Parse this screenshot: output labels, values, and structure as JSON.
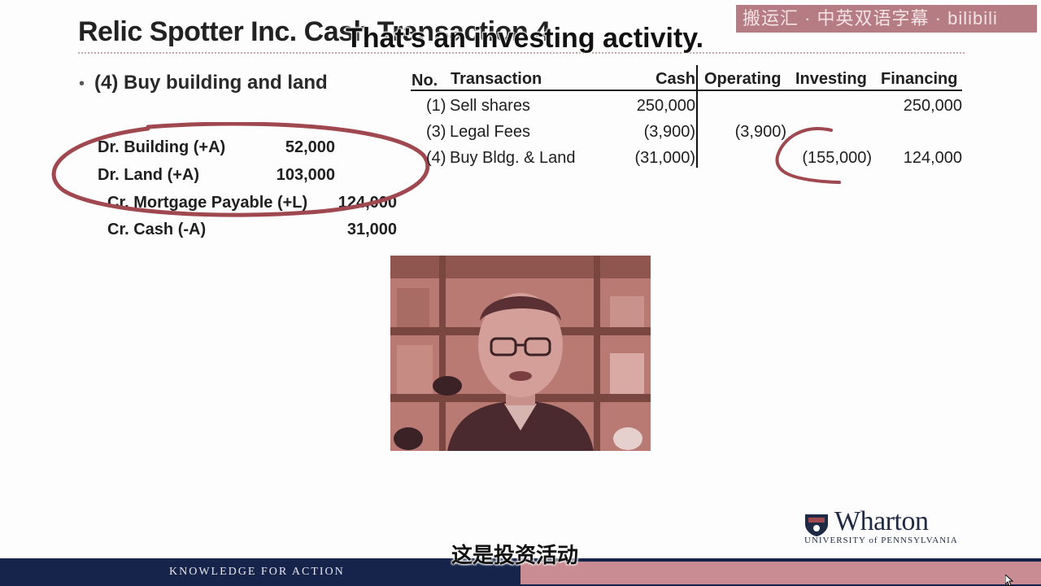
{
  "slide": {
    "title": "Relic Spotter Inc. Cash Transaction 4",
    "bullet": "(4) Buy building  and land"
  },
  "journal_entry": [
    {
      "account": "Dr. Building (+A)",
      "amount": "52,000"
    },
    {
      "account": "Dr. Land (+A)",
      "amount": "103,000"
    },
    {
      "account": "Cr. Mortgage Payable (+L)",
      "amount": "124,000"
    },
    {
      "account": "Cr. Cash (-A)",
      "amount": "31,000"
    }
  ],
  "table": {
    "headers": {
      "no": "No.",
      "transaction": "Transaction",
      "cash": "Cash",
      "operating": "Operating",
      "investing": "Investing",
      "financing": "Financing"
    },
    "rows": [
      {
        "no": "(1)",
        "transaction": "Sell shares",
        "cash": "250,000",
        "operating": "",
        "investing": "",
        "financing": "250,000"
      },
      {
        "no": "(3)",
        "transaction": "Legal Fees",
        "cash": "(3,900)",
        "operating": "(3,900)",
        "investing": "",
        "financing": ""
      },
      {
        "no": "(4)",
        "transaction": "Buy Bldg. & Land",
        "cash": "(31,000)",
        "operating": "",
        "investing": "(155,000)",
        "financing": "124,000"
      }
    ]
  },
  "subtitles": {
    "english": "That's an investing activity.",
    "chinese": "这是投资活动"
  },
  "watermark": "搬运汇 · 中英双语字幕 · bilibili",
  "branding": {
    "wharton": "Wharton",
    "university": "UNIVERSITY of PENNSYLVANIA",
    "footer": "KNOWLEDGE FOR ACTION"
  },
  "colors": {
    "annotation_red": "#a0484f",
    "footer_navy": "#16234a",
    "footer_pink": "#c98c93"
  }
}
